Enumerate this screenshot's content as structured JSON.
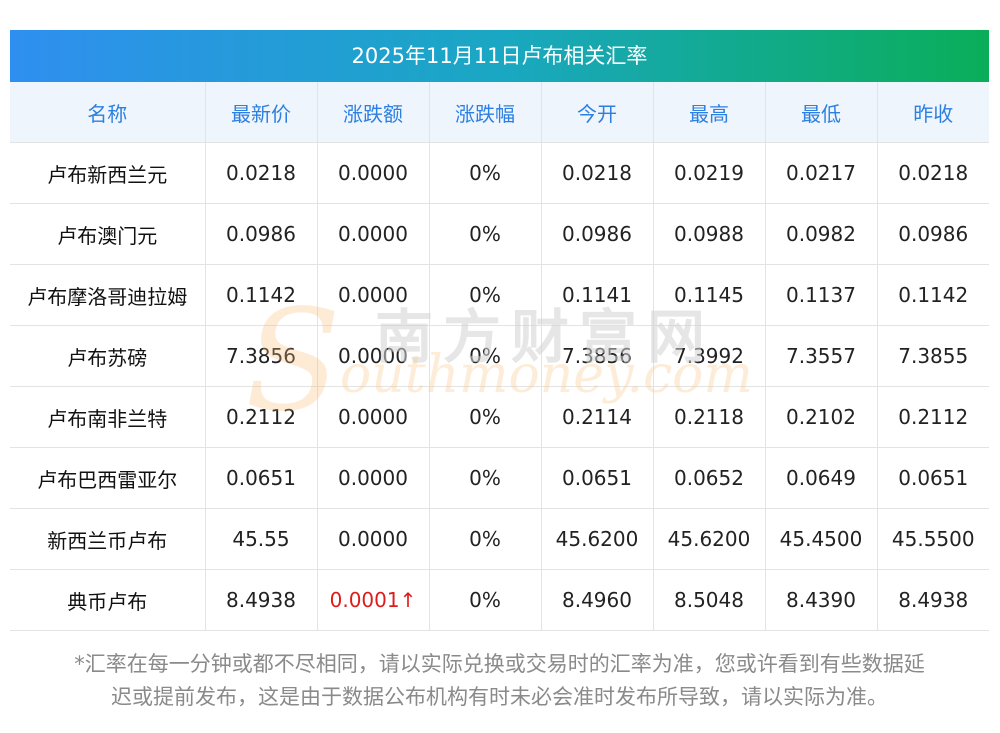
{
  "title": "2025年11月11日卢布相关汇率",
  "columns": [
    "名称",
    "最新价",
    "涨跌额",
    "涨跌幅",
    "今开",
    "最高",
    "最低",
    "昨收"
  ],
  "rows": [
    {
      "name": "卢布新西兰元",
      "latest": "0.0218",
      "change": "0.0000",
      "pct": "0%",
      "open": "0.0218",
      "high": "0.0219",
      "low": "0.0217",
      "prev": "0.0218"
    },
    {
      "name": "卢布澳门元",
      "latest": "0.0986",
      "change": "0.0000",
      "pct": "0%",
      "open": "0.0986",
      "high": "0.0988",
      "low": "0.0982",
      "prev": "0.0986"
    },
    {
      "name": "卢布摩洛哥迪拉姆",
      "latest": "0.1142",
      "change": "0.0000",
      "pct": "0%",
      "open": "0.1141",
      "high": "0.1145",
      "low": "0.1137",
      "prev": "0.1142"
    },
    {
      "name": "卢布苏磅",
      "latest": "7.3856",
      "change": "0.0000",
      "pct": "0%",
      "open": "7.3856",
      "high": "7.3992",
      "low": "7.3557",
      "prev": "7.3855"
    },
    {
      "name": "卢布南非兰特",
      "latest": "0.2112",
      "change": "0.0000",
      "pct": "0%",
      "open": "0.2114",
      "high": "0.2118",
      "low": "0.2102",
      "prev": "0.2112"
    },
    {
      "name": "卢布巴西雷亚尔",
      "latest": "0.0651",
      "change": "0.0000",
      "pct": "0%",
      "open": "0.0651",
      "high": "0.0652",
      "low": "0.0649",
      "prev": "0.0651"
    },
    {
      "name": "新西兰币卢布",
      "latest": "45.55",
      "change": "0.0000",
      "pct": "0%",
      "open": "45.6200",
      "high": "45.6200",
      "low": "45.4500",
      "prev": "45.5500"
    },
    {
      "name": "典币卢布",
      "latest": "8.4938",
      "change": "0.0001↑",
      "pct": "0%",
      "open": "8.4960",
      "high": "8.5048",
      "low": "8.4390",
      "prev": "8.4938"
    }
  ],
  "note_line1": "*汇率在每一分钟或都不尽相同，请以实际兑换或交易时的汇率为准，您或许看到有些数据延",
  "note_line2": "迟或提前发布，这是由于数据公布机构有时未必会准时发布所导致，请以实际为准。",
  "watermark": {
    "cn": "南方财富网",
    "en": "outhmoney.com",
    "s": "S"
  },
  "colors": {
    "header_text": "#2d7fe0",
    "header_bg": "#eef5fd",
    "up": "#e01b1b",
    "title_gradient_start": "#2f8ff0",
    "title_gradient_end": "#0aae58"
  }
}
